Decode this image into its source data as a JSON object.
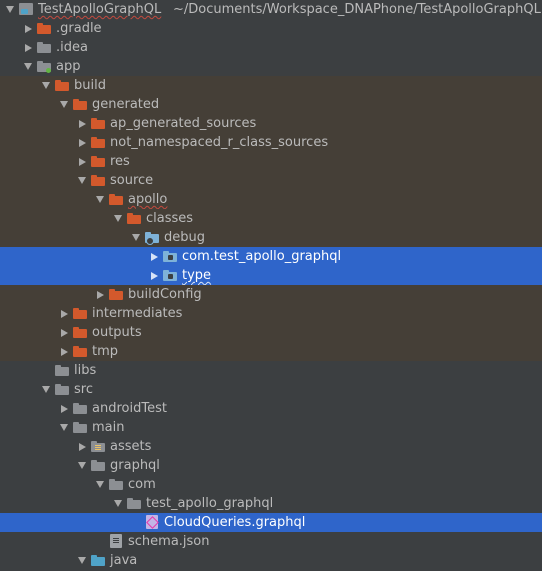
{
  "colors": {
    "background": "#3c3f41",
    "excluded_row_background": "#453f37",
    "selection": "#2f65ca",
    "text": "#bbbbbb",
    "folder_orange": "#d3592c",
    "folder_gray": "#8c8f93",
    "folder_blue": "#7eb2d8",
    "module_dot": "#62b543"
  },
  "tree": [
    {
      "label": "TestApolloGraphQL",
      "path": "~/Documents/Workspace_DNAPhone/TestApolloGraphQL",
      "depth": 0,
      "arrow": "down",
      "icon": "project-icon",
      "style": "normal",
      "spell": true
    },
    {
      "label": ".gradle",
      "depth": 1,
      "arrow": "right",
      "icon": "folder-orange-icon",
      "style": "normal"
    },
    {
      "label": ".idea",
      "depth": 1,
      "arrow": "right",
      "icon": "folder-gray-icon",
      "style": "normal"
    },
    {
      "label": "app",
      "depth": 1,
      "arrow": "down",
      "icon": "module-folder-icon",
      "style": "normal"
    },
    {
      "label": "build",
      "depth": 2,
      "arrow": "down",
      "icon": "folder-orange-icon",
      "style": "excluded"
    },
    {
      "label": "generated",
      "depth": 3,
      "arrow": "down",
      "icon": "folder-orange-icon",
      "style": "excluded"
    },
    {
      "label": "ap_generated_sources",
      "depth": 4,
      "arrow": "right",
      "icon": "folder-orange-icon",
      "style": "excluded"
    },
    {
      "label": "not_namespaced_r_class_sources",
      "depth": 4,
      "arrow": "right",
      "icon": "folder-orange-icon",
      "style": "excluded"
    },
    {
      "label": "res",
      "depth": 4,
      "arrow": "right",
      "icon": "folder-orange-icon",
      "style": "excluded"
    },
    {
      "label": "source",
      "depth": 4,
      "arrow": "down",
      "icon": "folder-orange-icon",
      "style": "excluded"
    },
    {
      "label": "apollo",
      "depth": 5,
      "arrow": "down",
      "icon": "folder-orange-icon",
      "style": "excluded",
      "spell": true
    },
    {
      "label": "classes",
      "depth": 6,
      "arrow": "down",
      "icon": "folder-orange-icon",
      "style": "excluded"
    },
    {
      "label": "debug",
      "depth": 7,
      "arrow": "down",
      "icon": "source-root-folder-icon",
      "style": "excluded"
    },
    {
      "label": "com.test_apollo_graphql",
      "depth": 8,
      "arrow": "right",
      "icon": "package-folder-icon",
      "style": "selected"
    },
    {
      "label": "type",
      "depth": 8,
      "arrow": "right",
      "icon": "package-folder-icon",
      "style": "selected",
      "spell": true
    },
    {
      "label": "buildConfig",
      "depth": 5,
      "arrow": "right",
      "icon": "folder-orange-icon",
      "style": "excluded"
    },
    {
      "label": "intermediates",
      "depth": 3,
      "arrow": "right",
      "icon": "folder-orange-icon",
      "style": "excluded"
    },
    {
      "label": "outputs",
      "depth": 3,
      "arrow": "right",
      "icon": "folder-orange-icon",
      "style": "excluded"
    },
    {
      "label": "tmp",
      "depth": 3,
      "arrow": "right",
      "icon": "folder-orange-icon",
      "style": "excluded"
    },
    {
      "label": "libs",
      "depth": 2,
      "arrow": "none",
      "icon": "folder-gray-icon",
      "style": "normal"
    },
    {
      "label": "src",
      "depth": 2,
      "arrow": "down",
      "icon": "folder-gray-icon",
      "style": "normal"
    },
    {
      "label": "androidTest",
      "depth": 3,
      "arrow": "right",
      "icon": "folder-gray-icon",
      "style": "normal"
    },
    {
      "label": "main",
      "depth": 3,
      "arrow": "down",
      "icon": "folder-gray-icon",
      "style": "normal"
    },
    {
      "label": "assets",
      "depth": 4,
      "arrow": "right",
      "icon": "resources-folder-icon",
      "style": "normal"
    },
    {
      "label": "graphql",
      "depth": 4,
      "arrow": "down",
      "icon": "folder-gray-icon",
      "style": "normal"
    },
    {
      "label": "com",
      "depth": 5,
      "arrow": "down",
      "icon": "folder-gray-icon",
      "style": "normal"
    },
    {
      "label": "test_apollo_graphql",
      "depth": 6,
      "arrow": "down",
      "icon": "folder-gray-icon",
      "style": "normal"
    },
    {
      "label": "CloudQueries.graphql",
      "depth": 7,
      "arrow": "none",
      "icon": "graphql-file-icon",
      "style": "selected"
    },
    {
      "label": "schema.json",
      "depth": 5,
      "arrow": "none",
      "icon": "json-file-icon",
      "style": "normal"
    },
    {
      "label": "java",
      "depth": 4,
      "arrow": "down",
      "icon": "source-folder-blue-icon",
      "style": "normal"
    }
  ]
}
